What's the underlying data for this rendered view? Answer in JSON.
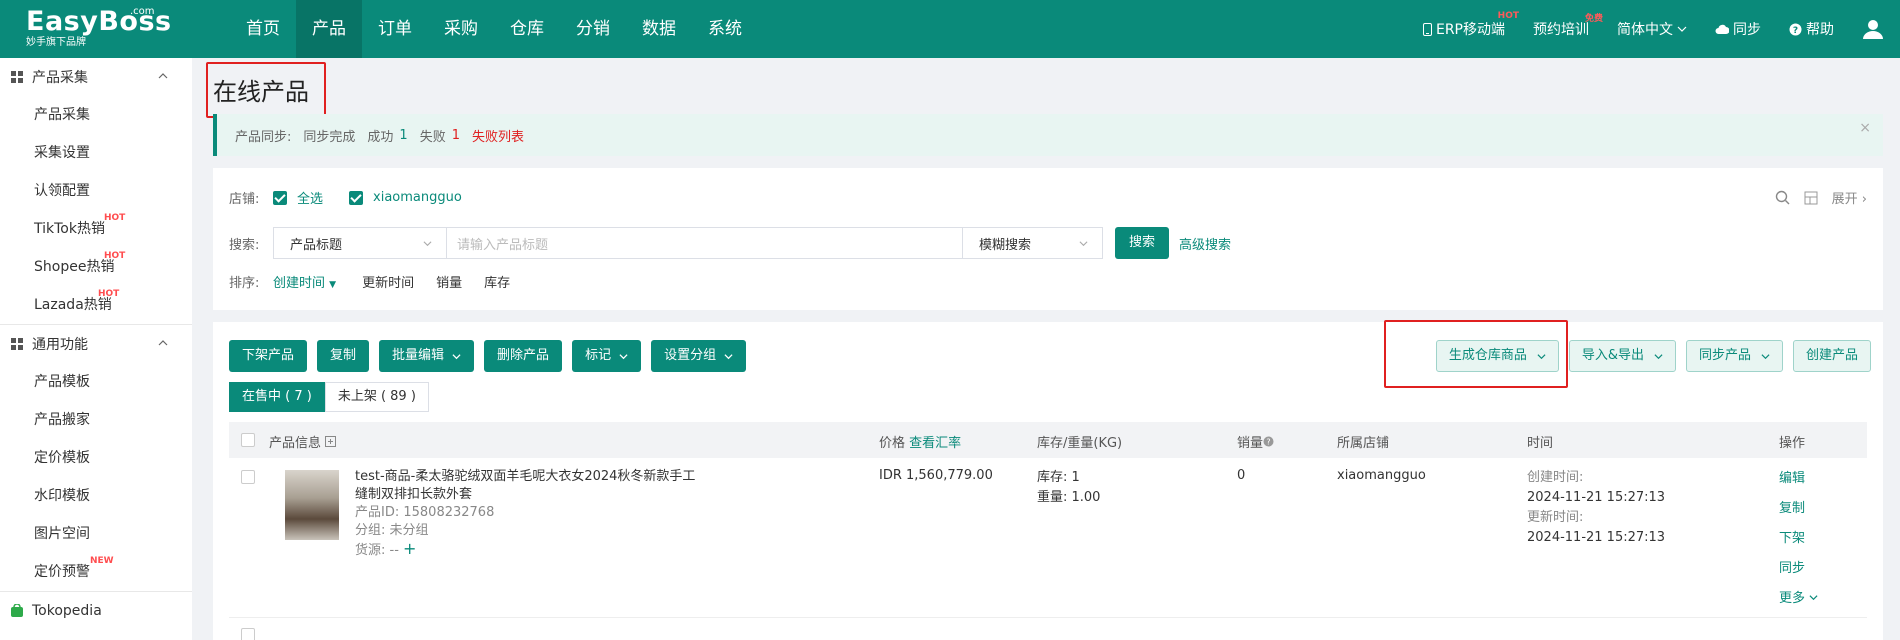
{
  "brand": {
    "name": "EasyBoss",
    "dotcom": ".com",
    "tagline": "妙手旗下品牌"
  },
  "nav": [
    {
      "label": "首页"
    },
    {
      "label": "产品",
      "active": true
    },
    {
      "label": "订单"
    },
    {
      "label": "采购"
    },
    {
      "label": "仓库"
    },
    {
      "label": "分销"
    },
    {
      "label": "数据"
    },
    {
      "label": "系统"
    }
  ],
  "topright": {
    "erp": "ERP移动端",
    "erp_badge": "HOT",
    "training": "预约培训",
    "training_badge": "免费",
    "lang": "简体中文",
    "sync": "同步",
    "help": "帮助"
  },
  "sidebar": {
    "group1": "产品采集",
    "group1_items": [
      {
        "label": "产品采集"
      },
      {
        "label": "采集设置"
      },
      {
        "label": "认领配置"
      },
      {
        "label": "TikTok热销",
        "badge": "HOT"
      },
      {
        "label": "Shopee热销",
        "badge": "HOT"
      },
      {
        "label": "Lazada热销",
        "badge": "HOT"
      }
    ],
    "group2": "通用功能",
    "group2_items": [
      {
        "label": "产品模板"
      },
      {
        "label": "产品搬家"
      },
      {
        "label": "定价模板"
      },
      {
        "label": "水印模板"
      },
      {
        "label": "图片空间"
      },
      {
        "label": "定价预警",
        "badge": "NEW"
      }
    ],
    "group3": "Tokopedia"
  },
  "page": {
    "title": "在线产品"
  },
  "alert": {
    "label": "产品同步:",
    "status": "同步完成",
    "success_label": "成功",
    "success_count": "1",
    "fail_label": "失败",
    "fail_count": "1",
    "fail_list": "失败列表",
    "close": "×"
  },
  "filter": {
    "shop_label": "店铺:",
    "select_all": "全选",
    "shop_name": "xiaomangguo",
    "search_label": "搜索:",
    "search_field": "产品标题",
    "search_placeholder": "请输入产品标题",
    "search_mode": "模糊搜索",
    "search_btn": "搜索",
    "advanced": "高级搜索",
    "sort_label": "排序:",
    "sort_active": "创建时间",
    "sort_items": [
      "更新时间",
      "销量",
      "库存"
    ],
    "expand": "展开"
  },
  "toolbar": {
    "buttons": [
      "下架产品",
      "复制",
      "批量编辑",
      "删除产品",
      "标记",
      "设置分组"
    ],
    "right_buttons": [
      "生成仓库商品",
      "导入&导出",
      "同步产品",
      "创建产品"
    ]
  },
  "tabs": [
    {
      "label": "在售中 ( 7 )",
      "active": true
    },
    {
      "label": "未上架 ( 89 )"
    }
  ],
  "table": {
    "headers": {
      "info": "产品信息",
      "price": "价格",
      "rate": "查看汇率",
      "stock": "库存/重量(KG)",
      "sales": "销量",
      "shop": "所属店铺",
      "time": "时间",
      "ops": "操作"
    },
    "rows": [
      {
        "title_line1": "test-商品-柔太骆驼绒双面羊毛呢大衣女2024秋冬新款手工",
        "title_line2": "缝制双排扣长款外套",
        "product_id": "产品ID:  15808232768",
        "group": "分组:  未分组",
        "source": "货源:  --",
        "add": "+",
        "price": "IDR 1,560,779.00",
        "stock": "库存:   1",
        "weight": "重量:   1.00",
        "sales": "0",
        "shop": "xiaomangguo",
        "created_label": "创建时间:",
        "created": "2024-11-21 15:27:13",
        "updated_label": "更新时间:",
        "updated": "2024-11-21 15:27:13",
        "ops": [
          "编辑",
          "复制",
          "下架",
          "同步",
          "更多"
        ]
      }
    ]
  },
  "colors": {
    "primary": "#0a8a7a",
    "danger": "#e02020",
    "highlight_box": "#e02020"
  }
}
